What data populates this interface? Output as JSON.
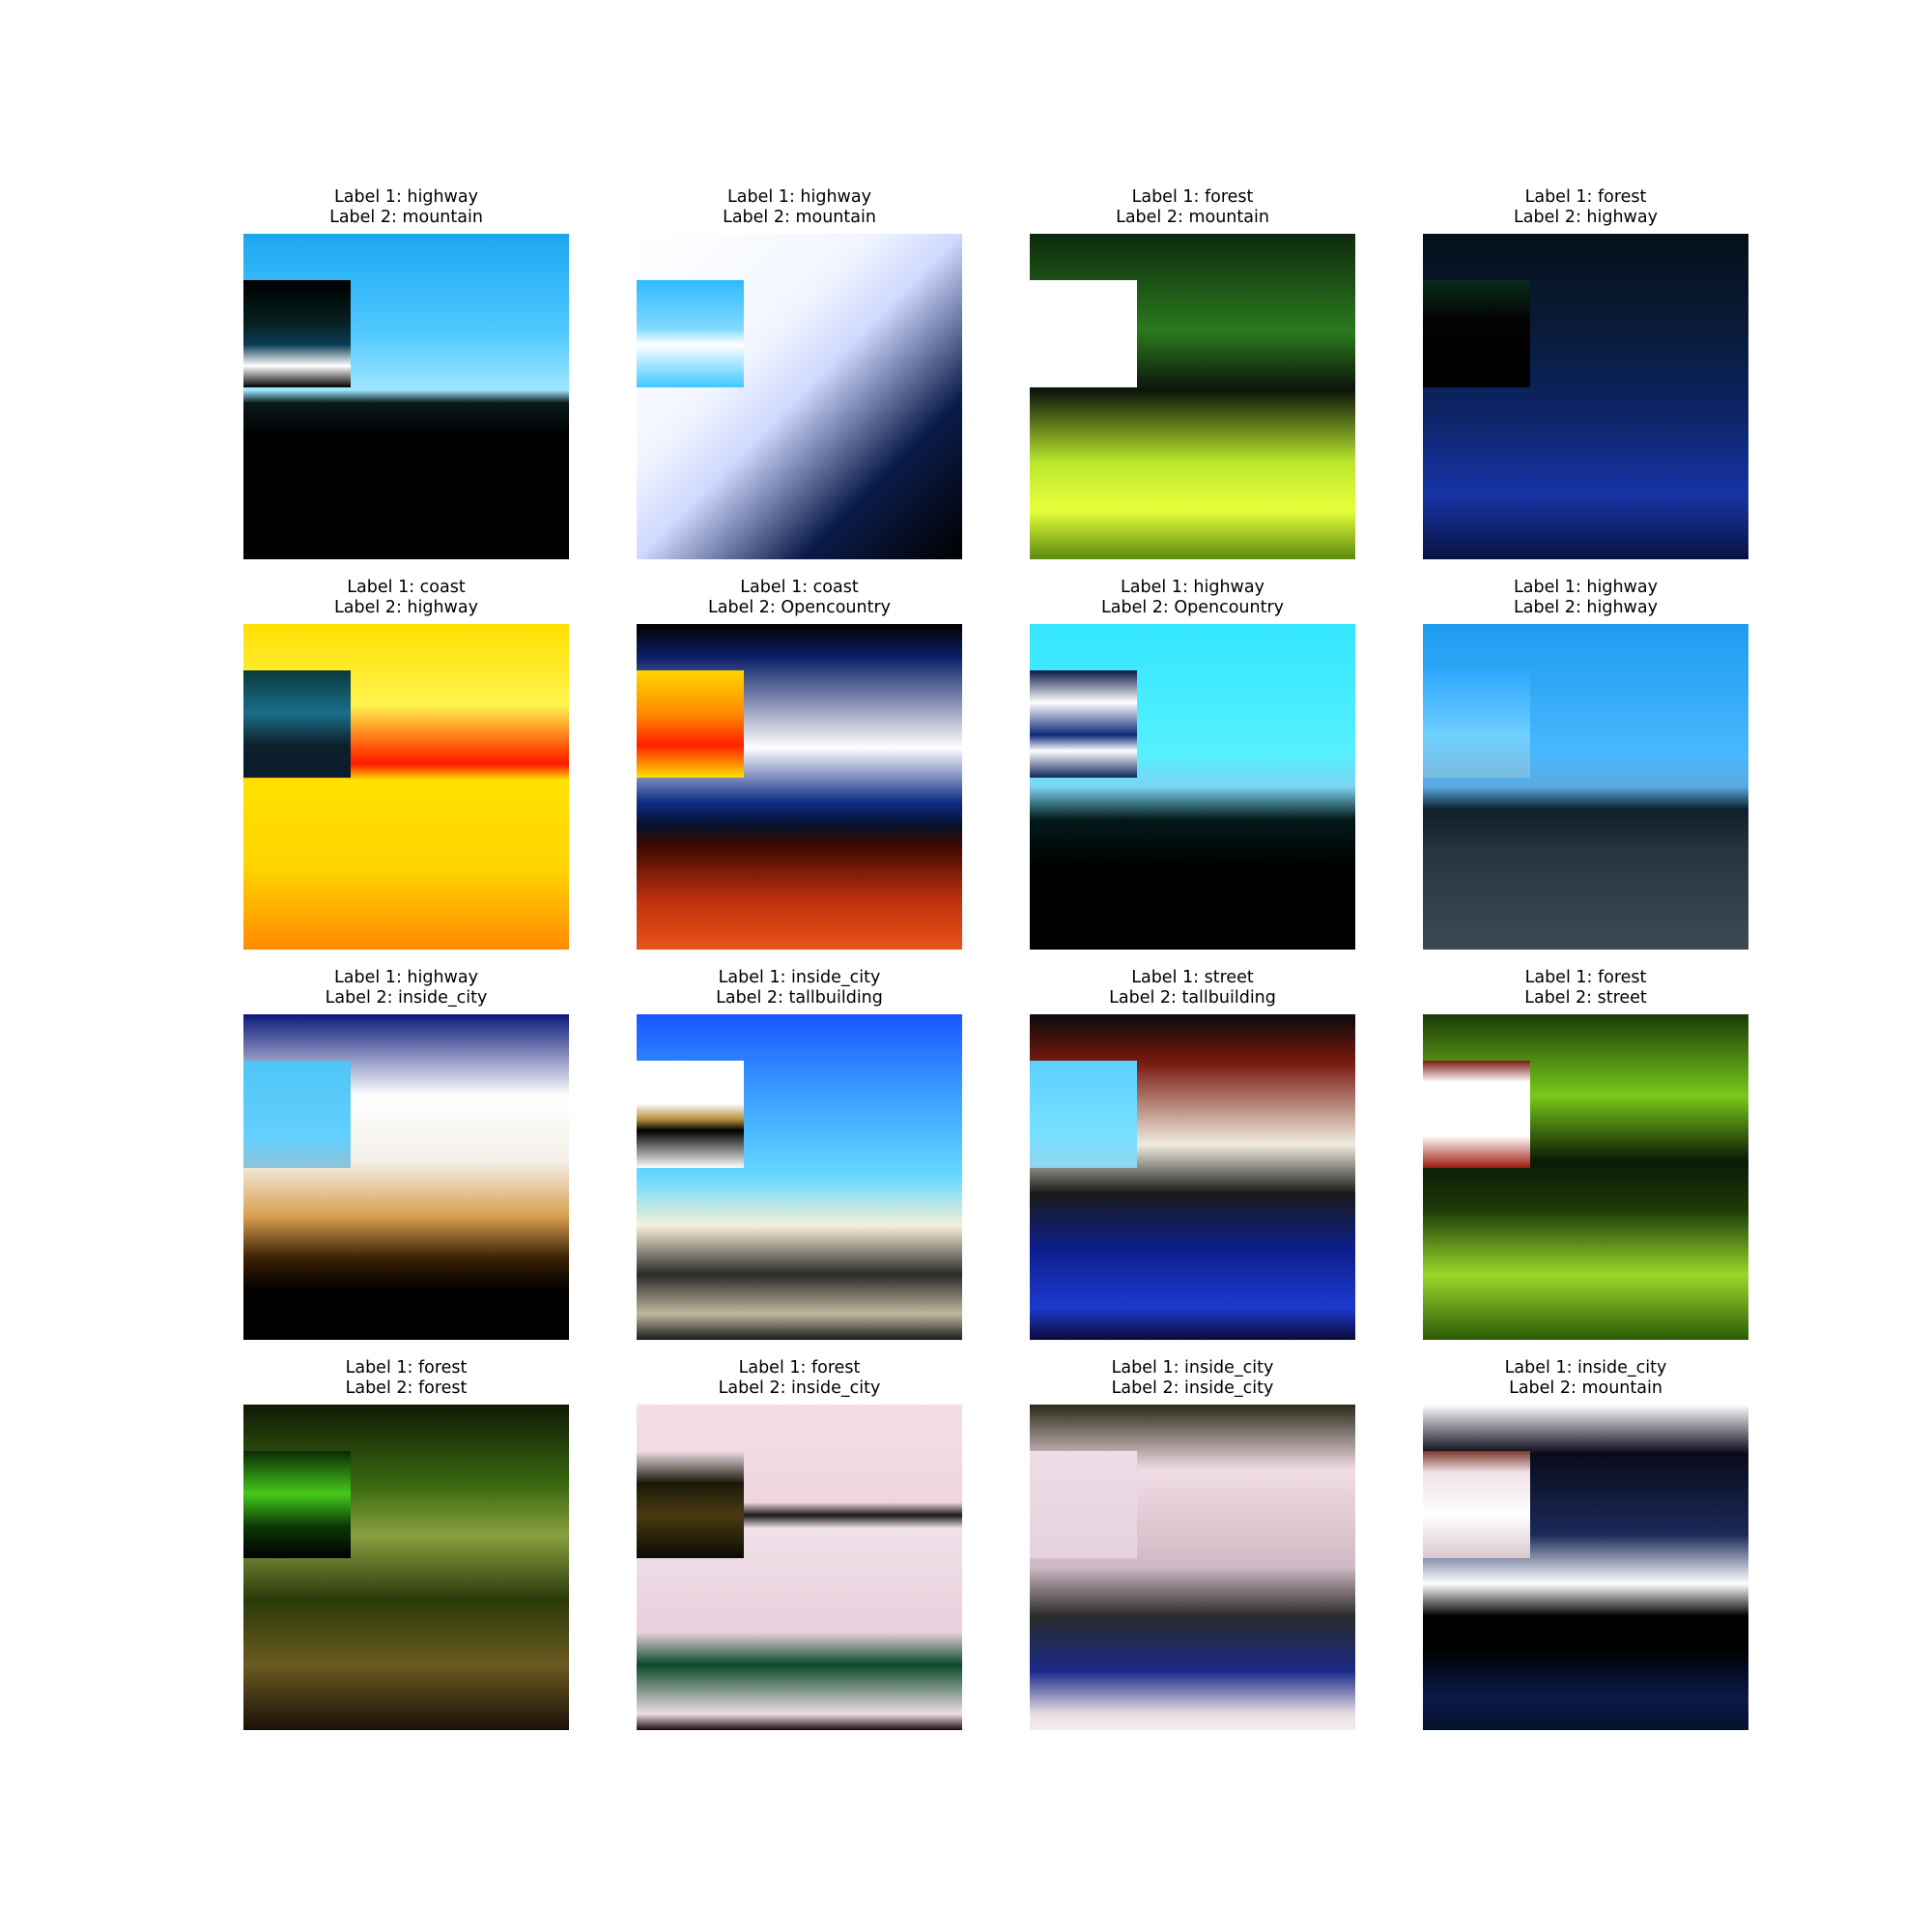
{
  "figure": {
    "panels": [
      {
        "label1": "Label 1: highway",
        "label2": "Label 2: mountain",
        "bg": "linear-gradient(180deg,#1aa7f0 0%,#4fc8ff 30%,#9fe6ff 48%,#071a1a 52%,#000 62%,#000 100%)",
        "patch": "linear-gradient(180deg,#000 0%,#062020 40%,#0a3d55 60%,#ffffff 80%,#000 100%)"
      },
      {
        "label1": "Label 1: highway",
        "label2": "Label 2: mountain",
        "bg": "linear-gradient(135deg,#ffffff 0%,#f2f6ff 35%,#cfd9ff 50%,#0b1c4a 75%,#000 100%)",
        "patch": "linear-gradient(180deg,#2fbaff 0%,#7fd9ff 45%,#ffffff 60%,#40c8ff 100%)"
      },
      {
        "label1": "Label 1: forest",
        "label2": "Label 2: mountain",
        "bg": "linear-gradient(180deg,#0e2a0e 0%,#2b7a1c 30%,#0b140b 48%,#b9e62e 70%,#e7ff3a 85%,#5a8a10 100%)",
        "patch": "linear-gradient(180deg,#ffffff 0%,#ffffff 100%)"
      },
      {
        "label1": "Label 1: forest",
        "label2": "Label 2: highway",
        "bg": "linear-gradient(180deg,#041018 0%,#0a1b3a 30%,#0c2466 55%,#1734a6 80%,#081440 100%)",
        "patch": "linear-gradient(180deg,#0a2a1a 0%,#020202 40%,#000 100%)"
      },
      {
        "label1": "Label 1: coast",
        "label2": "Label 2: highway",
        "bg": "linear-gradient(180deg,#ffe000 0%,#fff34d 25%,#ff3a00 40%,#ff1a00 43%,#ffe100 48%,#ffd400 75%,#ff8a00 100%)",
        "patch": "linear-gradient(180deg,#0a3c3c 0%,#1b6d8a 40%,#0d1f2a 70%,#0a1b2e 100%)"
      },
      {
        "label1": "Label 1: coast",
        "label2": "Label 2: Opencountry",
        "bg": "linear-gradient(180deg,#000 0%,#0b1f66 10%,#ffffff 38%,#0d2a86 55%,#05112a 62%,#3d0a00 68%,#c0310e 85%,#e8531b 100%)",
        "patch": "linear-gradient(180deg,#ffd400 0%,#ff8c00 40%,#ff2000 70%,#ffe000 100%)"
      },
      {
        "label1": "Label 1: highway",
        "label2": "Label 2: Opencountry",
        "bg": "linear-gradient(180deg,#33e6ff 0%,#55f0ff 40%,#7ad4f0 50%,#021a1a 60%,#000 75%,#000 100%)",
        "patch": "linear-gradient(180deg,#0b1a4a 0%,#ffffff 30%,#0c2a7a 60%,#ffffff 75%,#10265a 100%)"
      },
      {
        "label1": "Label 1: highway",
        "label2": "Label 2: highway",
        "bg": "linear-gradient(180deg,#1d9bf0 0%,#49b8ff 40%,#5aa9e0 50%,#0d1f2a 57%,#273540 70%,#3c4a55 100%)",
        "patch": "linear-gradient(180deg,#2ea7ff 0%,#6fcfff 60%,#7abbe0 100%)"
      },
      {
        "label1": "Label 1: highway",
        "label2": "Label 2: inside_city",
        "bg": "linear-gradient(180deg,#0b1a7a 0%,#ffffff 25%,#f4f0e8 45%,#d9a050 62%,#3a2005 75%,#000 85%,#000 100%)",
        "patch": "linear-gradient(180deg,#4ec5f5 0%,#62cfff 70%,#8dc4d8 100%)"
      },
      {
        "label1": "Label 1: inside_city",
        "label2": "Label 2: tallbuilding",
        "bg": "linear-gradient(180deg,#1a55ff 0%,#3aa0ff 25%,#66d9ff 50%,#f6efd8 65%,#2a2a2a 80%,#bfb8a0 92%,#1b1b1b 100%)",
        "patch": "linear-gradient(180deg,#ffffff 0%,#ffffff 40%,#b38c3a 55%,#000 65%,#ffffff 100%)"
      },
      {
        "label1": "Label 1: street",
        "label2": "Label 2: tallbuilding",
        "bg": "linear-gradient(180deg,#0a0a0a 0%,#7a1a10 15%,#f0ece0 40%,#1a1a1a 55%,#0c1e8a 72%,#1e3ad0 90%,#0a0a3a 100%)",
        "patch": "linear-gradient(180deg,#5ad0ff 0%,#78e0ff 70%,#8fd4f0 100%)"
      },
      {
        "label1": "Label 1: forest",
        "label2": "Label 2: street",
        "bg": "linear-gradient(180deg,#1a3a08 0%,#7ac91a 25%,#0b1a05 45%,#1c3a08 60%,#9ad82a 80%,#2d5a08 100%)",
        "patch": "linear-gradient(180deg,#7a1a10 0%,#ffffff 20%,#ffffff 70%,#a01a10 100%)"
      },
      {
        "label1": "Label 1: forest",
        "label2": "Label 2: forest",
        "bg": "linear-gradient(180deg,#101a05 0%,#3a6a10 25%,#8aa040 40%,#2b3a0a 60%,#6a5a20 80%,#1a1008 100%)",
        "patch": "linear-gradient(180deg,#0a2a05 0%,#46c91a 40%,#0b3a08 70%,#000 100%)"
      },
      {
        "label1": "Label 1: forest",
        "label2": "Label 2: inside_city",
        "bg": "linear-gradient(180deg,#f2dfe8 0%,#efd5e0 30%,#1a1a1a 34%,#f0e0e8 38%,#e8d0dc 70%,#0a4a2a 80%,#f0dde6 95%,#1a0a0a 100%)",
        "patch": "linear-gradient(180deg,#f0dde8 0%,#1a1a0a 30%,#4a3a10 60%,#0a0a05 100%)"
      },
      {
        "label1": "Label 1: inside_city",
        "label2": "Label 2: inside_city",
        "bg": "linear-gradient(180deg,#2a2a1a 0%,#f0dce4 20%,#cfb9c4 50%,#2a2a2a 65%,#1a2a8a 82%,#e8dde4 95%,#f4eef0 100%)",
        "patch": "linear-gradient(180deg,#f0dce6 0%,#e6d2de 100%)"
      },
      {
        "label1": "Label 1: inside_city",
        "label2": "Label 2: mountain",
        "bg": "linear-gradient(180deg,#ffffff 0%,#0a0a1a 15%,#1a2a5a 40%,#ffffff 55%,#000 65%,#000 75%,#0a1a4a 90%,#06122e 100%)",
        "patch": "linear-gradient(180deg,#7a3a2a 0%,#f0e0e8 20%,#ffffff 60%,#d8c8d0 100%)"
      }
    ]
  }
}
